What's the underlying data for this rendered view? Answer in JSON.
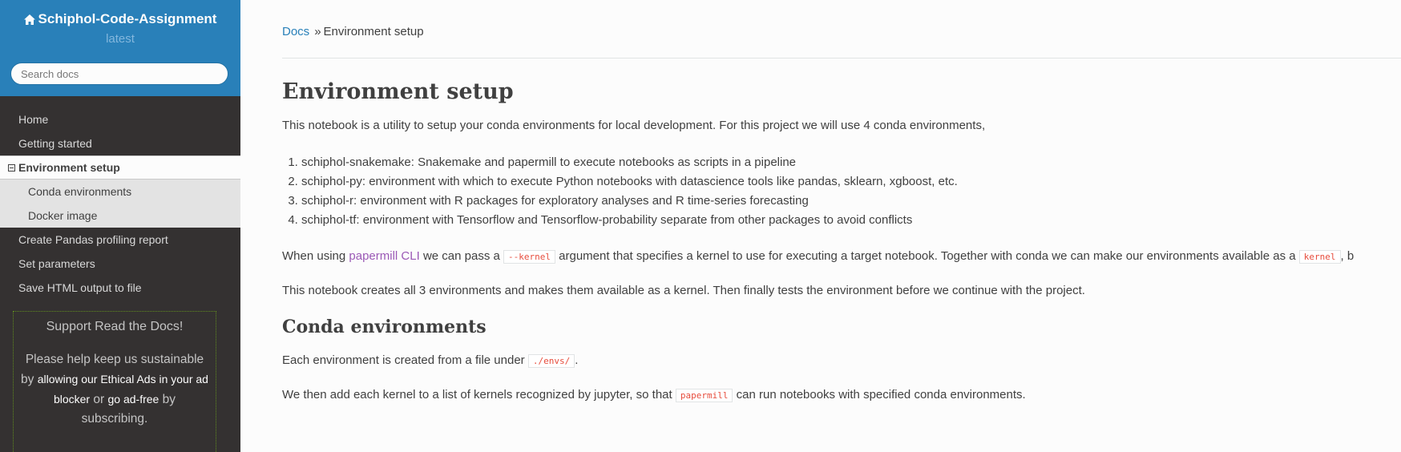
{
  "sidebar": {
    "project_title": "Schiphol-Code-Assignment",
    "version": "latest",
    "search_placeholder": "Search docs",
    "nav": [
      {
        "label": "Home"
      },
      {
        "label": "Getting started"
      },
      {
        "label": "Environment setup",
        "current": true
      },
      {
        "label": "Conda environments",
        "sub": true
      },
      {
        "label": "Docker image",
        "sub": true
      },
      {
        "label": "Create Pandas profiling report"
      },
      {
        "label": "Set parameters"
      },
      {
        "label": "Save HTML output to file"
      }
    ],
    "support": {
      "title": "Support Read the Docs!",
      "text_1": "Please help keep us sustainable by",
      "link_1": "allowing our Ethical Ads in your ad blocker",
      "text_2": "or",
      "link_2": "go ad-free",
      "text_3": "by subscribing."
    }
  },
  "breadcrumb": {
    "root": "Docs",
    "separator": "»",
    "current": "Environment setup"
  },
  "content": {
    "h1": "Environment setup",
    "intro": "This notebook is a utility to setup your conda environments for local development. For this project we will use 4 conda environments,",
    "list": [
      "schiphol-snakemake: Snakemake and papermill to execute notebooks as scripts in a pipeline",
      "schiphol-py: environment with which to execute Python notebooks with datascience tools like pandas, sklearn, xgboost, etc.",
      "schiphol-r: environment with R packages for exploratory analyses and R time-series forecasting",
      "schiphol-tf: environment with Tensorflow and Tensorflow-probability separate from other packages to avoid conflicts"
    ],
    "p2": {
      "t1": "When using",
      "link": "papermill CLI",
      "t2": "we can pass a",
      "code1": "--kernel",
      "t3": "argument that specifies a kernel to use for executing a target notebook. Together with conda we can make our environments available as a",
      "code2": "kernel",
      "t4": ", b"
    },
    "p3": "This notebook creates all 3 environments and makes them available as a kernel. Then finally tests the environment before we continue with the project.",
    "h2": "Conda environments",
    "p4": {
      "t1": "Each environment is created from a file under",
      "code": "./envs/",
      "t2": "."
    },
    "p5": {
      "t1": "We then add each kernel to a list of kernels recognized by jupyter, so that",
      "code": "papermill",
      "t2": "can run notebooks with specified conda environments."
    }
  },
  "colors": {
    "sidebar_bg": "#343131",
    "header_bg": "#2980b9",
    "link": "#2980b9",
    "visited_link": "#9b59b6",
    "code": "#e74c3c"
  }
}
